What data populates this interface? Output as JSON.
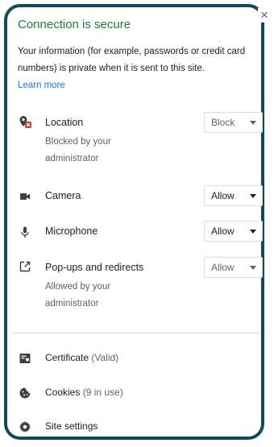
{
  "header": {
    "title": "Connection is secure",
    "description": "Your information (for example, passwords or credit card numbers) is private when it is sent to this site.",
    "learn_more": "Learn more",
    "close_symbol": "×"
  },
  "permissions": [
    {
      "label": "Location",
      "icon": "location-blocked-icon",
      "value": "Block",
      "note": "Blocked by your administrator",
      "managed": true
    },
    {
      "label": "Camera",
      "icon": "camera-icon",
      "value": "Allow",
      "note": "",
      "managed": false
    },
    {
      "label": "Microphone",
      "icon": "microphone-icon",
      "value": "Allow",
      "note": "",
      "managed": false
    },
    {
      "label": "Pop-ups and redirects",
      "icon": "popup-icon",
      "value": "Allow",
      "note": "Allowed by your administrator",
      "managed": true
    }
  ],
  "links": {
    "certificate": {
      "label": "Certificate",
      "note": "(Valid)",
      "icon": "certificate-icon"
    },
    "cookies": {
      "label": "Cookies",
      "note": "(9 in use)",
      "icon": "cookie-icon"
    },
    "site_settings": {
      "label": "Site settings",
      "icon": "gear-icon"
    }
  },
  "colors": {
    "secure_green": "#188038",
    "link_blue": "#1a73e8",
    "frame": "#0f4a5c",
    "blocked_red": "#d93025"
  }
}
